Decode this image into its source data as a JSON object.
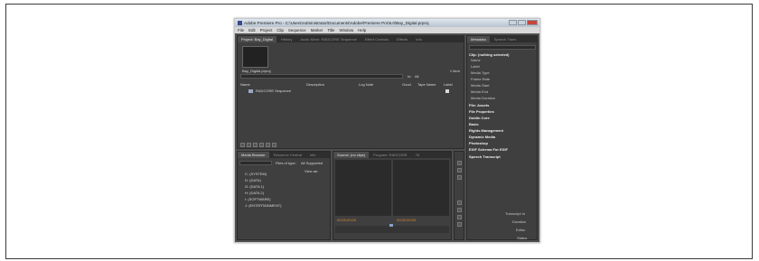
{
  "window": {
    "title": "Adobe Premiere Pro - C:\\Users\\Administrator\\Documents\\Adobe\\Premiere Pro\\5.0\\Bay_Digital.prproj"
  },
  "menubar": [
    "File",
    "Edit",
    "Project",
    "Clip",
    "Sequence",
    "Marker",
    "Title",
    "Window",
    "Help"
  ],
  "project_panel": {
    "tabs": [
      "Project: Bay_Digital",
      "History",
      "Audio Mixer: RADCORE Sequence",
      "Effect Controls",
      "Effects",
      "Info"
    ],
    "filename": "Bay_Digital.prproj",
    "item_count": "1 Item",
    "in_label": "In:",
    "in_value": "All",
    "columns": [
      "Name",
      "Description",
      "Log Note",
      "Good",
      "Tape Name",
      "Label"
    ],
    "item": "RADCORE Sequence"
  },
  "metadata_panel": {
    "tabs": [
      "Metadata",
      "Speech Trans"
    ],
    "clip_header": "Clip: (nothing selected)",
    "clip_fields": [
      "Name",
      "Label",
      "Media Type",
      "Frame Rate",
      "Media Start",
      "Media End",
      "Media Duration"
    ],
    "sections": [
      "File: Assets",
      "File Properties",
      "Dublin Core",
      "Basic",
      "Rights Management",
      "Dynamic Media",
      "Photoshop",
      "EXIF Schema For EXIF",
      "Speech Transcript"
    ],
    "transcript_fields": [
      "Transcript In",
      "Duration",
      "Editor",
      "Status"
    ]
  },
  "media_browser": {
    "tabs": [
      "Media Browser",
      "Resource Central",
      "Info"
    ],
    "files_of_type_label": "Files of type:",
    "files_of_type_value": "All Supported",
    "view_as_label": "View as:",
    "drives": [
      "C: (SYSTEM)",
      "D: (DATA)",
      "G: (DATA 1)",
      "H: (DATA 2)",
      "I: (SOFTWARE)",
      "J: (ENTERTAINMENT)"
    ]
  },
  "source_monitor": {
    "tabs": [
      "Source: (no clips)",
      "Program: RADCORE",
      "Tit"
    ],
    "timecode": "00;00;00;00"
  },
  "colors": {
    "accent": "#e08a2c",
    "panel": "#3f3f3f",
    "background": "#4e4e4e"
  }
}
